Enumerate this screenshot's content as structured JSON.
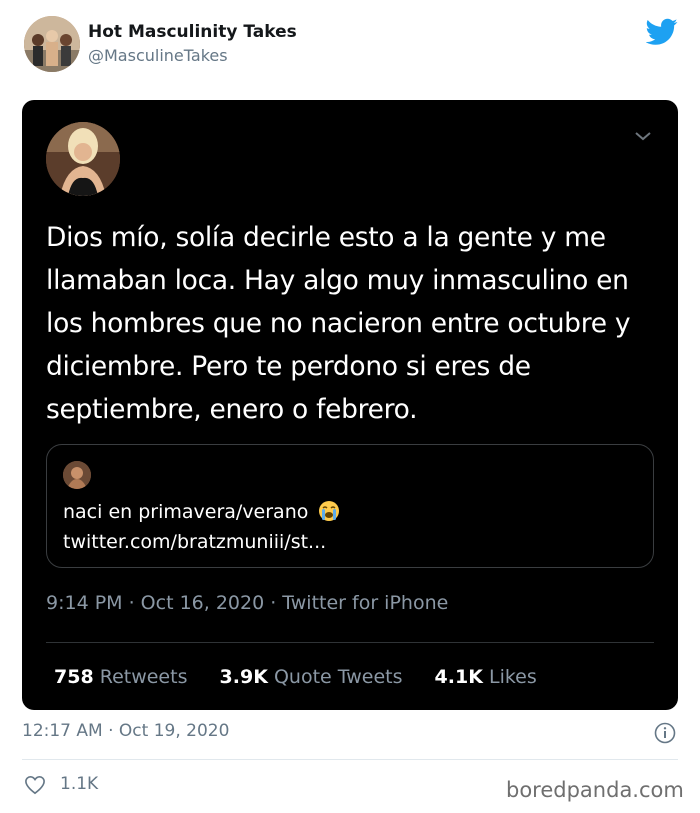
{
  "outer_tweet": {
    "display_name": "Hot Masculinity Takes",
    "handle": "@MasculineTakes",
    "timestamp": "12:17 AM · Oct 19, 2020",
    "like_count": "1.1K",
    "brand_color": "#1da1f2"
  },
  "screenshot": {
    "tweet_text": "Dios mío, solía decirle esto a la gente y me llamaban loca. Hay algo muy inmasculino en los hombres que no nacieron entre octubre y diciembre. Pero te perdono si eres de septiembre, enero o febrero.",
    "quote": {
      "text": "naci en primavera/verano",
      "emoji": "loudly-crying-face",
      "link": "twitter.com/bratzmuniii/st..."
    },
    "meta": "9:14 PM · Oct 16, 2020 · Twitter for iPhone",
    "stats": [
      {
        "count": "758",
        "label": "Retweets"
      },
      {
        "count": "3.9K",
        "label": "Quote Tweets"
      },
      {
        "count": "4.1K",
        "label": "Likes"
      }
    ]
  },
  "watermark": "boredpanda.com"
}
